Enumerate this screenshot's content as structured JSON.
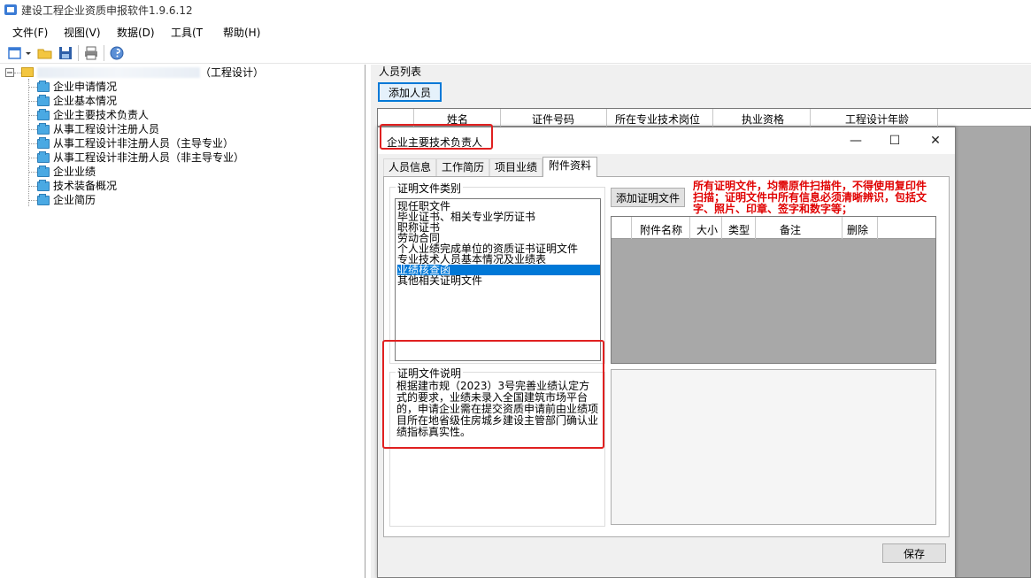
{
  "app": {
    "title": "建设工程企业资质申报软件1.9.6.12"
  },
  "menu": [
    {
      "label": "文件(F)"
    },
    {
      "label": "视图(V)"
    },
    {
      "label": "数据(D)"
    },
    {
      "label": "工具(T"
    },
    {
      "label": "帮助(H)"
    }
  ],
  "tree": {
    "root_suffix": "（工程设计）",
    "items": [
      {
        "label": "企业申请情况"
      },
      {
        "label": "企业基本情况"
      },
      {
        "label": "企业主要技术负责人"
      },
      {
        "label": "从事工程设计注册人员"
      },
      {
        "label": "从事工程设计非注册人员（主导专业）"
      },
      {
        "label": "从事工程设计非注册人员（非主导专业）"
      },
      {
        "label": "企业业绩"
      },
      {
        "label": "技术装备概况"
      },
      {
        "label": "企业简历"
      }
    ]
  },
  "personnel": {
    "section_label": "人员列表",
    "add_button": "添加人员",
    "columns": [
      "姓名",
      "证件号码",
      "所在专业技术岗位",
      "执业资格",
      "工程设计年龄"
    ]
  },
  "dialog": {
    "title": "企业主要技术负责人",
    "tabs": [
      {
        "label": "人员信息",
        "active": false
      },
      {
        "label": "工作简历",
        "active": false
      },
      {
        "label": "项目业绩",
        "active": false
      },
      {
        "label": "附件资料",
        "active": true
      }
    ],
    "category_group_label": "证明文件类别",
    "categories": [
      "现任职文件",
      "毕业证书、相关专业学历证书",
      "职称证书",
      "劳动合同",
      "个人业绩完成单位的资质证书证明文件",
      "专业技术人员基本情况及业绩表",
      "业绩核查函",
      "其他相关证明文件"
    ],
    "selected_category_index": 6,
    "description_group_label": "证明文件说明",
    "description_text": "根据建市规（2023）3号完善业绩认定方式的要求，业绩未录入全国建筑市场平台的，申请企业需在提交资质申请前由业绩项目所在地省级住房城乡建设主管部门确认业绩指标真实性。",
    "add_file_button": "添加证明文件",
    "warning_text": "所有证明文件，均需原件扫描件，不得使用复印件扫描；证明文件中所有信息必须清晰辨识，包括文字、照片、印章、签字和数字等；",
    "attachment_columns": [
      "附件名称",
      "大小",
      "类型",
      "备注",
      "删除"
    ],
    "save_button": "保存",
    "colors": {
      "warning": "#e00000",
      "highlight_box": "#e02020",
      "selection": "#0078d7"
    }
  }
}
